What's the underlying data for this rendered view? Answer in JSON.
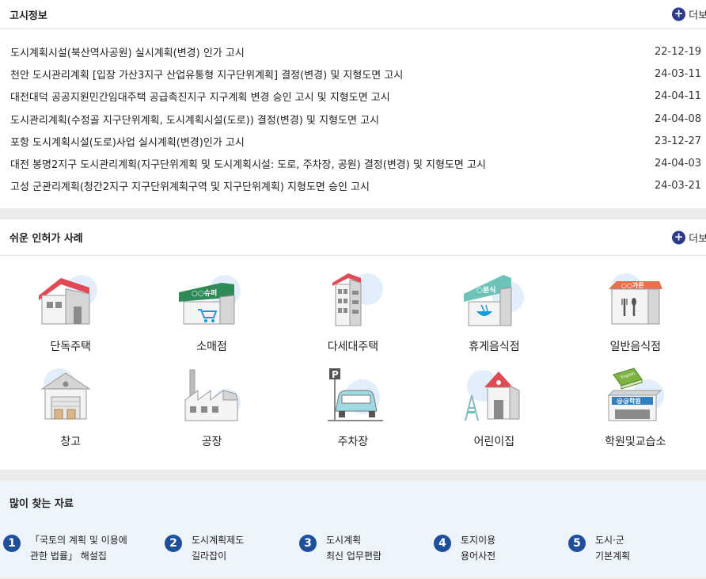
{
  "notices": {
    "title": "고시정보",
    "more_label": "더보기",
    "items": [
      {
        "title": "도시계획시설(북산역사공원) 실시계획(변경) 인가 고시",
        "date": "22-12-19"
      },
      {
        "title": "천안 도시관리계획 [입장 가산3지구 산업유통형 지구단위계획] 결정(변경) 및 지형도면 고시",
        "date": "24-03-11"
      },
      {
        "title": "대전대덕 공공지원민간임대주택 공급촉진지구 지구계획 변경 승인 고시 및 지형도면 고시",
        "date": "24-04-11"
      },
      {
        "title": "도시관리계획(수정골 지구단위계획, 도시계획시설(도로)) 결정(변경) 및 지형도면 고시",
        "date": "24-04-08"
      },
      {
        "title": "포항 도시계획시설(도로)사업 실시계획(변경)인가 고시",
        "date": "23-12-27"
      },
      {
        "title": "대전 봉명2지구 도시관리계획(지구단위계획 및 도시계획시설: 도로, 주차장, 공원) 결정(변경) 및 지형도면 고시",
        "date": "24-04-03"
      },
      {
        "title": "고성 군관리계획(청간2지구 지구단위계획구역 및 지구단위계획) 지형도면 승인 고시",
        "date": "24-03-21"
      }
    ]
  },
  "cases": {
    "title": "쉬운 인허가 사례",
    "more_label": "더보기",
    "items": [
      {
        "label": "단독주택",
        "icon": "house-icon"
      },
      {
        "label": "소매점",
        "icon": "store-icon",
        "sign": "○○슈퍼"
      },
      {
        "label": "다세대주택",
        "icon": "apartment-icon"
      },
      {
        "label": "휴게음식점",
        "icon": "snack-bar-icon",
        "sign": "○분식"
      },
      {
        "label": "일반음식점",
        "icon": "restaurant-icon",
        "sign": "○○가든"
      },
      {
        "label": "창고",
        "icon": "warehouse-icon"
      },
      {
        "label": "공장",
        "icon": "factory-icon"
      },
      {
        "label": "주차장",
        "icon": "parking-icon",
        "sign": "P"
      },
      {
        "label": "어린이집",
        "icon": "daycare-icon"
      },
      {
        "label": "학원및교습소",
        "icon": "academy-icon",
        "sign": "@@학원",
        "book": "English"
      }
    ]
  },
  "popular": {
    "title": "많이 찾는 자료",
    "items": [
      {
        "num": "1",
        "line1": "「국토의 계획 및 이용에",
        "line2": "관한 법률」 해설집"
      },
      {
        "num": "2",
        "line1": "도시계획제도",
        "line2": "길라잡이"
      },
      {
        "num": "3",
        "line1": "도시계획",
        "line2": "최신 업무편람"
      },
      {
        "num": "4",
        "line1": "토지이용",
        "line2": "용어사전"
      },
      {
        "num": "5",
        "line1": "도시·군",
        "line2": "기본계획"
      }
    ]
  },
  "colors": {
    "accent": "#2d3a8c",
    "number_badge": "#1f4f98",
    "popular_bg": "#eef4fb"
  }
}
